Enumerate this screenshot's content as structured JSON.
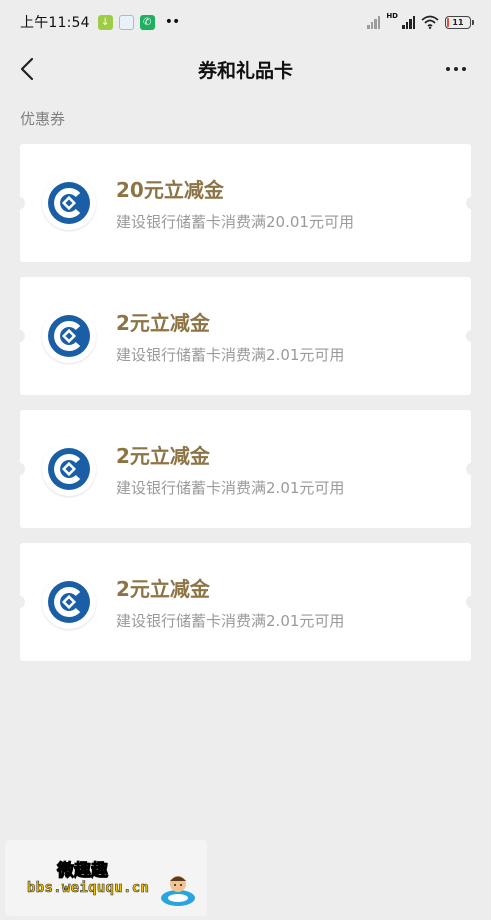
{
  "status_bar": {
    "time": "上午11:54",
    "battery": "11",
    "hd_label": "HD",
    "more_glyph": "••"
  },
  "header": {
    "title": "券和礼品卡",
    "back_icon": "chevron-left-icon",
    "more_icon": "more-dots-icon"
  },
  "section": {
    "label": "优惠券"
  },
  "coupons": [
    {
      "title": "20元立减金",
      "description": "建设银行储蓄卡消费满20.01元可用",
      "logo": "ccb-bank-logo"
    },
    {
      "title": "2元立减金",
      "description": "建设银行储蓄卡消费满2.01元可用",
      "logo": "ccb-bank-logo"
    },
    {
      "title": "2元立减金",
      "description": "建设银行储蓄卡消费满2.01元可用",
      "logo": "ccb-bank-logo"
    },
    {
      "title": "2元立减金",
      "description": "建设银行储蓄卡消费满2.01元可用",
      "logo": "ccb-bank-logo"
    }
  ],
  "watermark": {
    "site_name": "微趣趣",
    "url": "bbs.weiququ.cn"
  },
  "colors": {
    "background": "#ededed",
    "coupon_title": "#8c7445",
    "bank_logo": "#1a5ea6",
    "battery_low": "#e24a3a"
  }
}
